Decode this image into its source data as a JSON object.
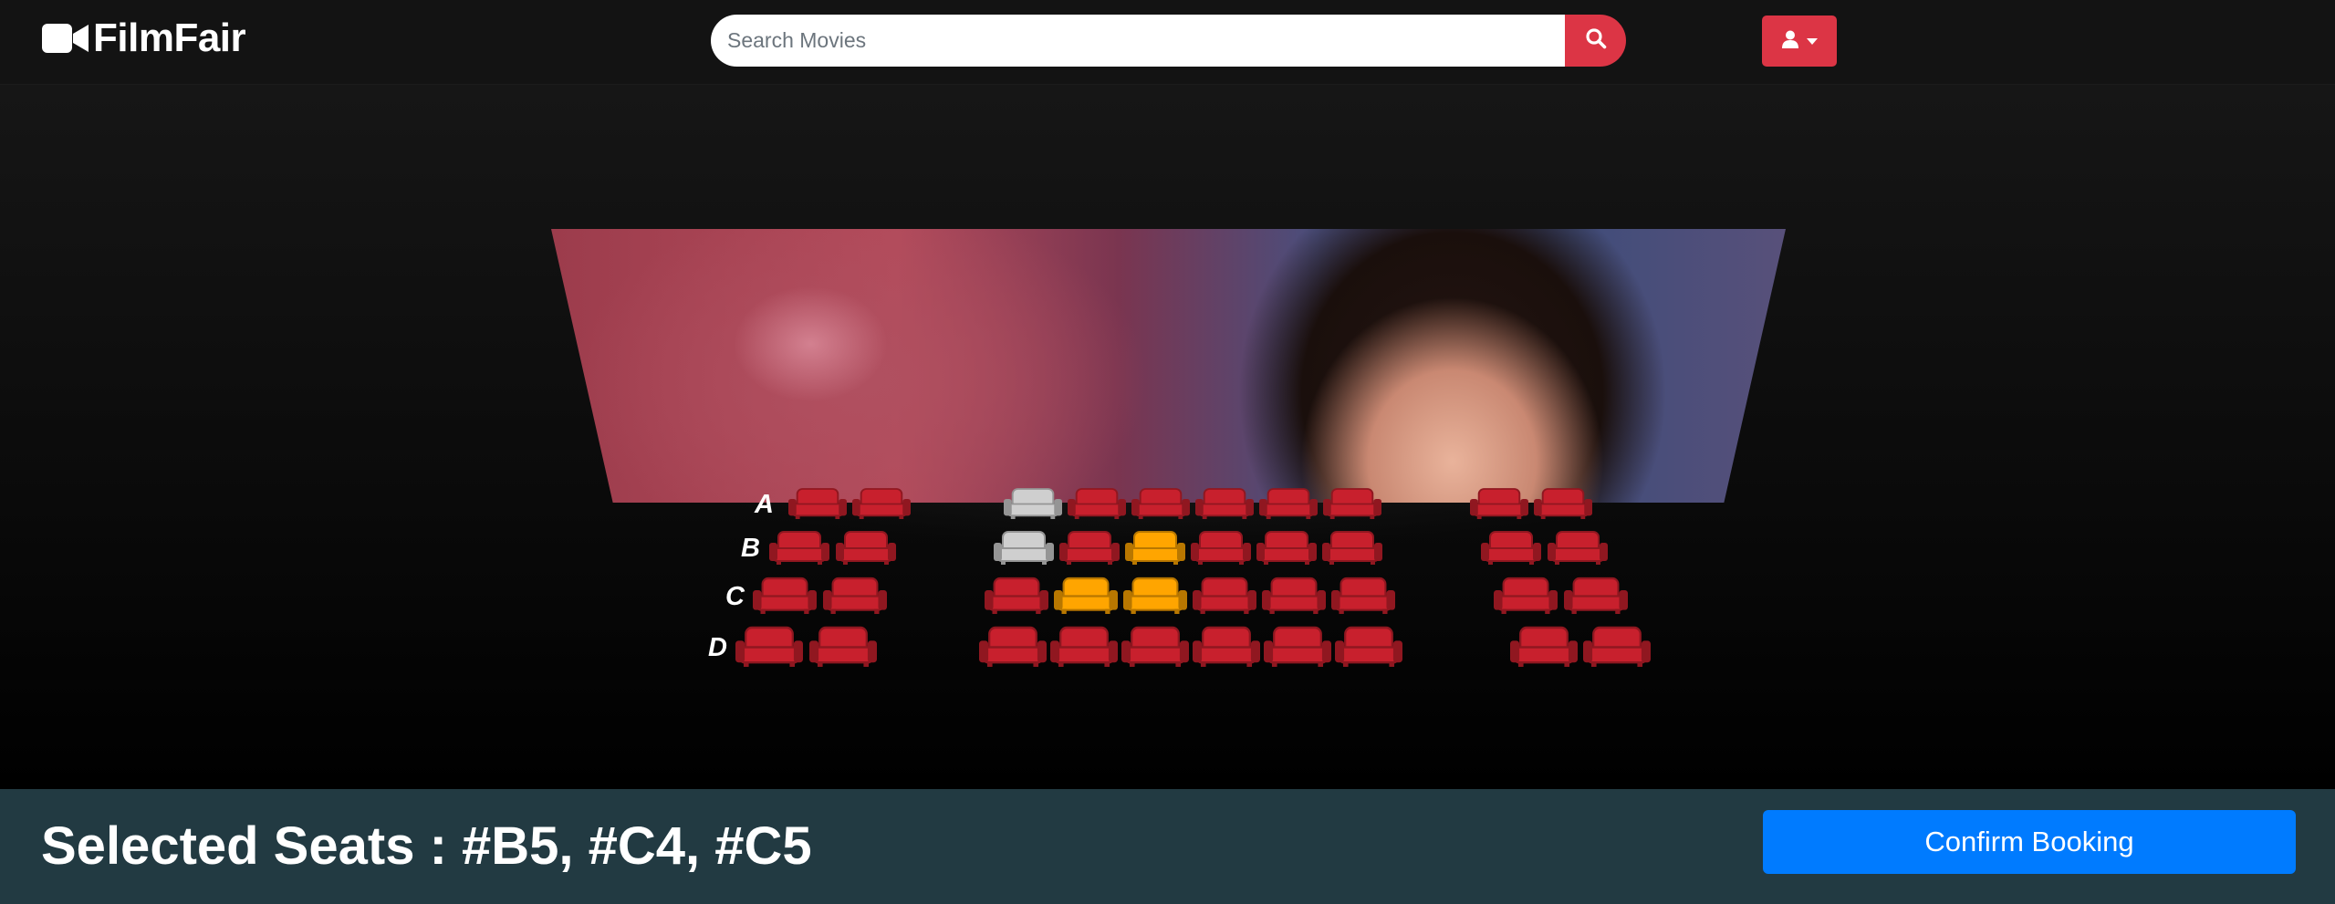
{
  "brand": {
    "name": "FilmFair",
    "icon": "video-camera-icon"
  },
  "search": {
    "placeholder": "Search Movies",
    "value": "",
    "button_icon": "search-icon"
  },
  "user_menu": {
    "icon": "user-icon"
  },
  "screen": {
    "description_icon": "movie-poster"
  },
  "seating": {
    "rows": [
      "A",
      "B",
      "C",
      "D"
    ],
    "sections": [
      {
        "name": "left",
        "seats_per_row": 2
      },
      {
        "name": "middle",
        "seats_per_row": 6
      },
      {
        "name": "right",
        "seats_per_row": 2
      }
    ],
    "occupied": [
      "A3",
      "B3"
    ],
    "selected": [
      "B5",
      "C4",
      "C5"
    ]
  },
  "footer": {
    "selected_seats_text": "Selected Seats : #B5, #C4, #C5",
    "confirm_label": "Confirm Booking"
  },
  "colors": {
    "navbar": "#131313",
    "accent_red": "#dc3545",
    "seat_available": "#c8202d",
    "seat_occupied": "#cfcfcf",
    "seat_selected": "#ffa500",
    "footer": "#223a42",
    "confirm": "#007bff"
  }
}
